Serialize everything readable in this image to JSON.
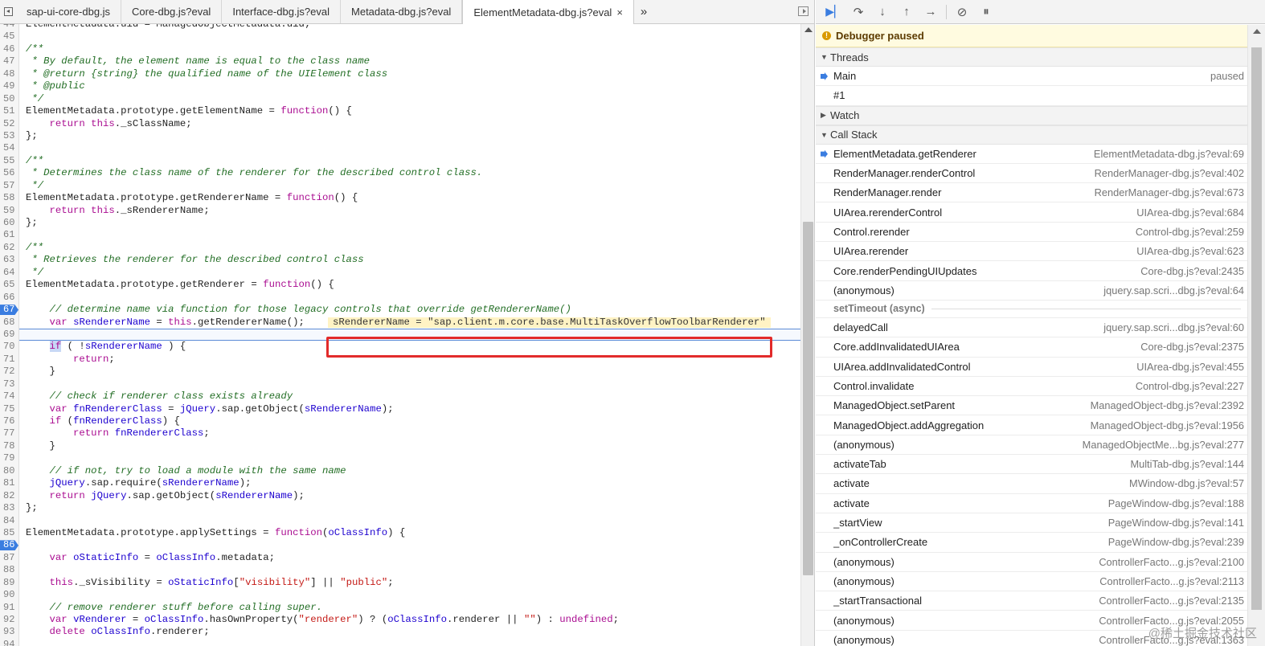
{
  "source_tabs": {
    "tabs": [
      {
        "label": "sap-ui-core-dbg.js",
        "active": false
      },
      {
        "label": "Core-dbg.js?eval",
        "active": false
      },
      {
        "label": "Interface-dbg.js?eval",
        "active": false
      },
      {
        "label": "Metadata-dbg.js?eval",
        "active": false
      },
      {
        "label": "ElementMetadata-dbg.js?eval",
        "active": true
      }
    ],
    "close_glyph": "×",
    "overflow_glyph": "»"
  },
  "code": {
    "breakpoint_lines": [
      "67",
      "86"
    ],
    "current_line": "69",
    "inline_value": "sRendererName = \"sap.client.m.core.base.MultiTaskOverflowToolbarRenderer\"",
    "lines": [
      {
        "n": "44",
        "html": "ElementMetadata.uid = ManagedObjectMetadata.uid;"
      },
      {
        "n": "45",
        "html": ""
      },
      {
        "n": "46",
        "html": "<span class=\"cmt\">/**</span>"
      },
      {
        "n": "47",
        "html": "<span class=\"cmt\"> * By default, the element name is equal to the class name</span>"
      },
      {
        "n": "48",
        "html": "<span class=\"cmt\"> * @return {string} the qualified name of the UIElement class</span>"
      },
      {
        "n": "49",
        "html": "<span class=\"cmt\"> * @public</span>"
      },
      {
        "n": "50",
        "html": "<span class=\"cmt\"> */</span>"
      },
      {
        "n": "51",
        "html": "ElementMetadata.prototype.getElementName = <span class=\"kw\">function</span>() {"
      },
      {
        "n": "52",
        "html": "    <span class=\"kw\">return this</span>._sClassName;"
      },
      {
        "n": "53",
        "html": "};"
      },
      {
        "n": "54",
        "html": ""
      },
      {
        "n": "55",
        "html": "<span class=\"cmt\">/**</span>"
      },
      {
        "n": "56",
        "html": "<span class=\"cmt\"> * Determines the class name of the renderer for the described control class.</span>"
      },
      {
        "n": "57",
        "html": "<span class=\"cmt\"> */</span>"
      },
      {
        "n": "58",
        "html": "ElementMetadata.prototype.getRendererName = <span class=\"kw\">function</span>() {"
      },
      {
        "n": "59",
        "html": "    <span class=\"kw\">return this</span>._sRendererName;"
      },
      {
        "n": "60",
        "html": "};"
      },
      {
        "n": "61",
        "html": ""
      },
      {
        "n": "62",
        "html": "<span class=\"cmt\">/**</span>"
      },
      {
        "n": "63",
        "html": "<span class=\"cmt\"> * Retrieves the renderer for the described control class</span>"
      },
      {
        "n": "64",
        "html": "<span class=\"cmt\"> */</span>"
      },
      {
        "n": "65",
        "html": "ElementMetadata.prototype.getRenderer = <span class=\"kw\">function</span>() {"
      },
      {
        "n": "66",
        "html": ""
      },
      {
        "n": "67",
        "html": "    <span class=\"cmt\">// determine name via function for those legacy controls that override getRendererName()</span>"
      },
      {
        "n": "68",
        "html": "    <span class=\"kw\">var</span> <span class=\"id\">sRendererName</span> = <span class=\"kw\">this</span>.getRendererName();"
      },
      {
        "n": "69",
        "html": ""
      },
      {
        "n": "70",
        "html": "    <span class=\"if-hl\">if</span> ( !<span class=\"id\">sRendererName</span> ) {"
      },
      {
        "n": "71",
        "html": "        <span class=\"kw\">return</span>;"
      },
      {
        "n": "72",
        "html": "    }"
      },
      {
        "n": "73",
        "html": ""
      },
      {
        "n": "74",
        "html": "    <span class=\"cmt\">// check if renderer class exists already</span>"
      },
      {
        "n": "75",
        "html": "    <span class=\"kw\">var</span> <span class=\"id\">fnRendererClass</span> = <span class=\"id\">jQuery</span>.sap.getObject(<span class=\"id\">sRendererName</span>);"
      },
      {
        "n": "76",
        "html": "    <span class=\"kw\">if</span> (<span class=\"id\">fnRendererClass</span>) {"
      },
      {
        "n": "77",
        "html": "        <span class=\"kw\">return</span> <span class=\"id\">fnRendererClass</span>;"
      },
      {
        "n": "78",
        "html": "    }"
      },
      {
        "n": "79",
        "html": ""
      },
      {
        "n": "80",
        "html": "    <span class=\"cmt\">// if not, try to load a module with the same name</span>"
      },
      {
        "n": "81",
        "html": "    <span class=\"id\">jQuery</span>.sap.require(<span class=\"id\">sRendererName</span>);"
      },
      {
        "n": "82",
        "html": "    <span class=\"kw\">return</span> <span class=\"id\">jQuery</span>.sap.getObject(<span class=\"id\">sRendererName</span>);"
      },
      {
        "n": "83",
        "html": "};"
      },
      {
        "n": "84",
        "html": ""
      },
      {
        "n": "85",
        "html": "ElementMetadata.prototype.applySettings = <span class=\"kw\">function</span>(<span class=\"id\">oClassInfo</span>) {"
      },
      {
        "n": "86",
        "html": ""
      },
      {
        "n": "87",
        "html": "    <span class=\"kw\">var</span> <span class=\"id\">oStaticInfo</span> = <span class=\"id\">oClassInfo</span>.metadata;"
      },
      {
        "n": "88",
        "html": ""
      },
      {
        "n": "89",
        "html": "    <span class=\"kw\">this</span>._sVisibility = <span class=\"id\">oStaticInfo</span>[<span class=\"str\">\"visibility\"</span>] || <span class=\"str\">\"public\"</span>;"
      },
      {
        "n": "90",
        "html": ""
      },
      {
        "n": "91",
        "html": "    <span class=\"cmt\">// remove renderer stuff before calling super.</span>"
      },
      {
        "n": "92",
        "html": "    <span class=\"kw\">var</span> <span class=\"id\">vRenderer</span> = <span class=\"id\">oClassInfo</span>.hasOwnProperty(<span class=\"str\">\"renderer\"</span>) ? (<span class=\"id\">oClassInfo</span>.renderer || <span class=\"str\">\"\"</span>) : <span class=\"kw\">undefined</span>;"
      },
      {
        "n": "93",
        "html": "    <span class=\"kw\">delete</span> <span class=\"id\">oClassInfo</span>.renderer;"
      },
      {
        "n": "94",
        "html": ""
      }
    ]
  },
  "debugger": {
    "paused_text": "Debugger paused",
    "threads_label": "Threads",
    "threads": [
      {
        "name": "Main",
        "status": "paused",
        "current": true
      },
      {
        "name": "#1",
        "status": "",
        "current": false
      }
    ],
    "watch_label": "Watch",
    "callstack_label": "Call Stack",
    "async_label": "setTimeout (async)",
    "frames_before_async": [
      {
        "name": "ElementMetadata.getRenderer",
        "loc": "ElementMetadata-dbg.js?eval:69",
        "current": true
      },
      {
        "name": "RenderManager.renderControl",
        "loc": "RenderManager-dbg.js?eval:402"
      },
      {
        "name": "RenderManager.render",
        "loc": "RenderManager-dbg.js?eval:673"
      },
      {
        "name": "UIArea.rerenderControl",
        "loc": "UIArea-dbg.js?eval:684"
      },
      {
        "name": "Control.rerender",
        "loc": "Control-dbg.js?eval:259"
      },
      {
        "name": "UIArea.rerender",
        "loc": "UIArea-dbg.js?eval:623"
      },
      {
        "name": "Core.renderPendingUIUpdates",
        "loc": "Core-dbg.js?eval:2435"
      },
      {
        "name": "(anonymous)",
        "loc": "jquery.sap.scri...dbg.js?eval:64"
      }
    ],
    "frames_after_async": [
      {
        "name": "delayedCall",
        "loc": "jquery.sap.scri...dbg.js?eval:60"
      },
      {
        "name": "Core.addInvalidatedUIArea",
        "loc": "Core-dbg.js?eval:2375"
      },
      {
        "name": "UIArea.addInvalidatedControl",
        "loc": "UIArea-dbg.js?eval:455"
      },
      {
        "name": "Control.invalidate",
        "loc": "Control-dbg.js?eval:227"
      },
      {
        "name": "ManagedObject.setParent",
        "loc": "ManagedObject-dbg.js?eval:2392"
      },
      {
        "name": "ManagedObject.addAggregation",
        "loc": "ManagedObject-dbg.js?eval:1956"
      },
      {
        "name": "(anonymous)",
        "loc": "ManagedObjectMe...bg.js?eval:277"
      },
      {
        "name": "activateTab",
        "loc": "MultiTab-dbg.js?eval:144"
      },
      {
        "name": "activate",
        "loc": "MWindow-dbg.js?eval:57"
      },
      {
        "name": "activate",
        "loc": "PageWindow-dbg.js?eval:188"
      },
      {
        "name": "_startView",
        "loc": "PageWindow-dbg.js?eval:141"
      },
      {
        "name": "_onControllerCreate",
        "loc": "PageWindow-dbg.js?eval:239"
      },
      {
        "name": "(anonymous)",
        "loc": "ControllerFacto...g.js?eval:2100"
      },
      {
        "name": "(anonymous)",
        "loc": "ControllerFacto...g.js?eval:2113"
      },
      {
        "name": "_startTransactional",
        "loc": "ControllerFacto...g.js?eval:2135"
      },
      {
        "name": "(anonymous)",
        "loc": "ControllerFacto...g.js?eval:2055"
      },
      {
        "name": "(anonymous)",
        "loc": "ControllerFacto...g.js?eval:1363"
      }
    ]
  },
  "toolbar": {
    "resume_icon": "resume-icon",
    "step_over_icon": "step-over-icon",
    "step_into_icon": "step-into-icon",
    "step_out_icon": "step-out-icon",
    "step_icon": "step-icon",
    "deactivate_icon": "deactivate-breakpoints-icon",
    "pause_exceptions_icon": "pause-on-exceptions-icon"
  },
  "watermark": "@稀土掘金技术社区",
  "colors": {
    "accent": "#3a7de0",
    "highlight_box": "#e22b2b",
    "paused_banner": "#fffbe0"
  }
}
